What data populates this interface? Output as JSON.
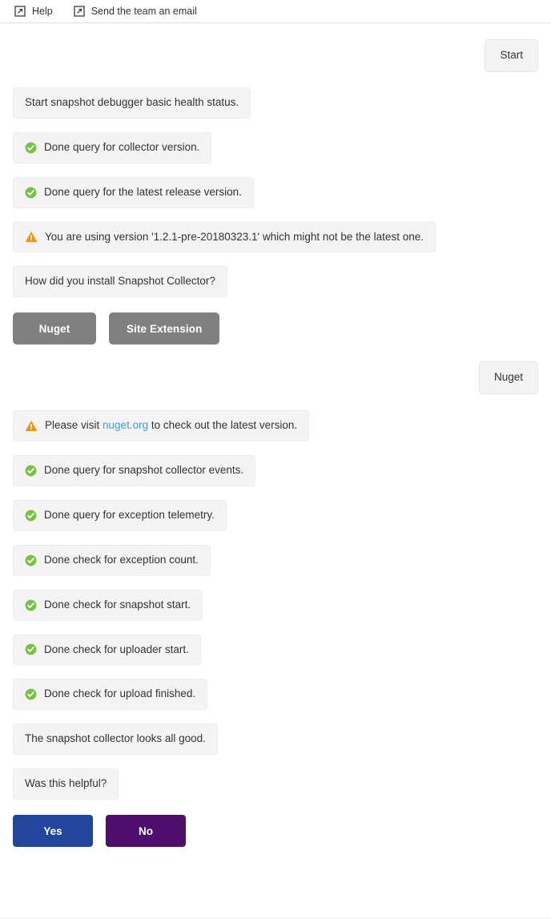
{
  "header": {
    "links": [
      {
        "label": "Help",
        "icon": "external-link-icon"
      },
      {
        "label": "Send the team an email",
        "icon": "external-link-icon"
      }
    ]
  },
  "colors": {
    "bubble_bg": "#f4f4f4",
    "bubble_border": "#ededed",
    "success_green": "#7ac143",
    "warning_orange": "#f2930d",
    "link_blue": "#3c9fe0",
    "choice_gray": "#808080",
    "yes_blue": "#21469c",
    "no_purple": "#4d0f6b",
    "text": "#333333"
  },
  "conversation": {
    "user_start": "Start",
    "msg_intro": "Start snapshot debugger basic health status.",
    "msg_collector_version": "Done query for collector version.",
    "msg_release_version": "Done query for the latest release version.",
    "msg_version_warning": "You are using version '1.2.1-pre-20180323.1' which might not be the latest one.",
    "msg_install_question": "How did you install Snapshot Collector?",
    "choice_nuget": "Nuget",
    "choice_site_extension": "Site Extension",
    "user_nuget": "Nuget",
    "msg_visit_prefix": "Please visit ",
    "msg_visit_link": "nuget.org",
    "msg_visit_suffix": " to check out the latest version.",
    "msg_snapshot_events": "Done query for snapshot collector events.",
    "msg_exception_telemetry": "Done query for exception telemetry.",
    "msg_exception_count": "Done check for exception count.",
    "msg_snapshot_start": "Done check for snapshot start.",
    "msg_uploader_start": "Done check for uploader start.",
    "msg_upload_finished": "Done check for upload finished.",
    "msg_all_good": "The snapshot collector looks all good.",
    "msg_was_helpful": "Was this helpful?",
    "answer_yes": "Yes",
    "answer_no": "No"
  }
}
